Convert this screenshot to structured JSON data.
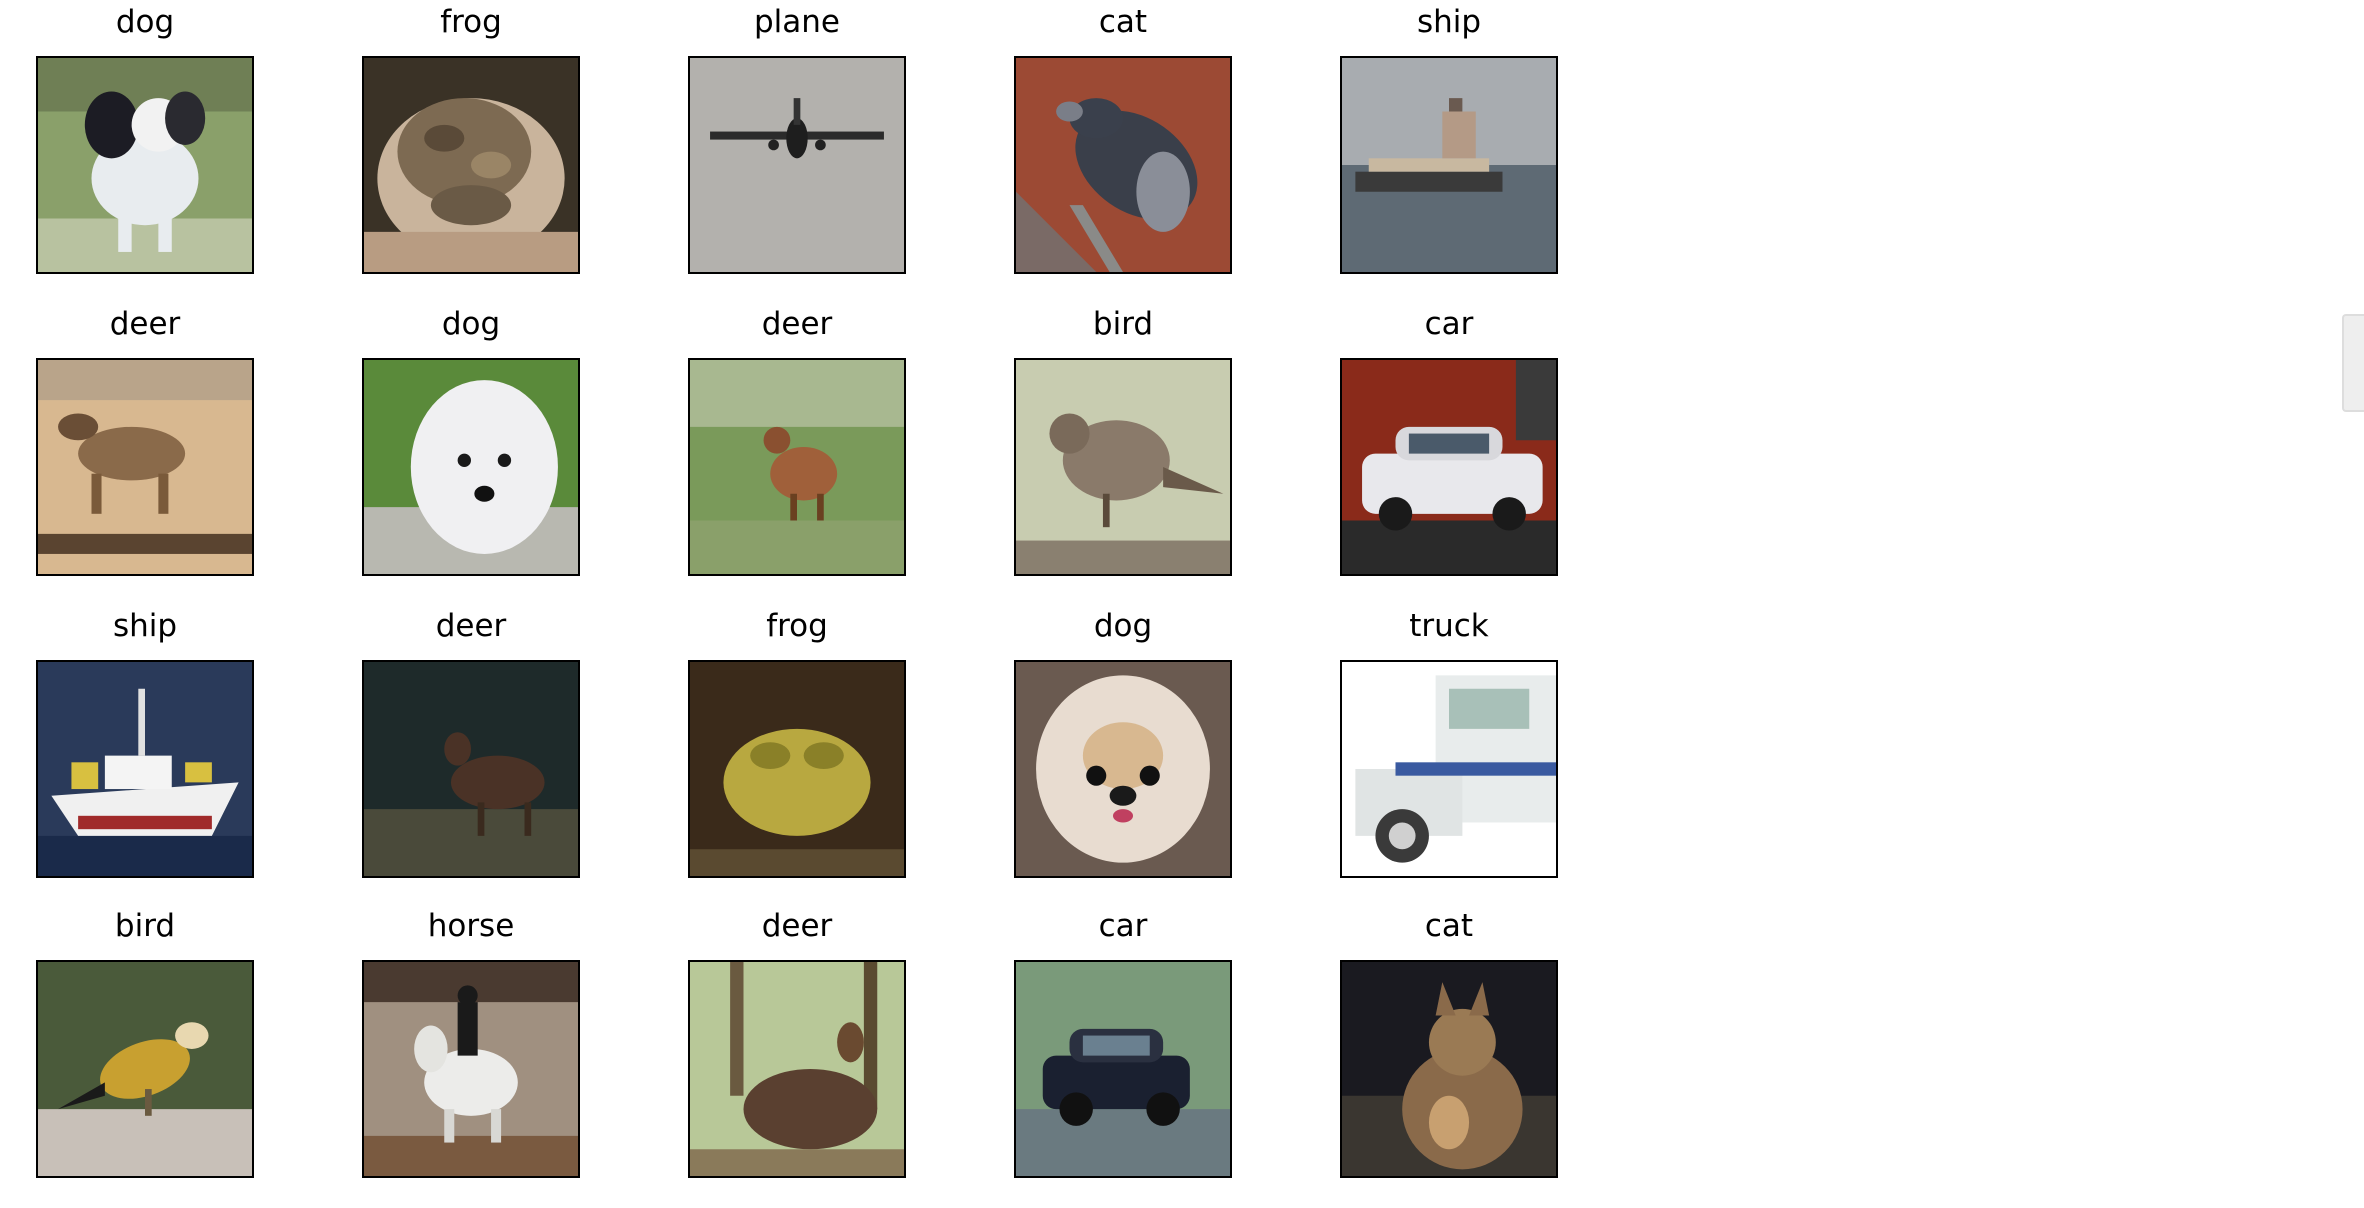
{
  "grid": {
    "rows": 4,
    "columns": 5,
    "cells": [
      {
        "label": "dog",
        "subject": "black-and-white small dog sitting on grass"
      },
      {
        "label": "frog",
        "subject": "brown toad held in a hand"
      },
      {
        "label": "plane",
        "subject": "airliner seen head-on against grey sky"
      },
      {
        "label": "cat",
        "subject": "grey tabby cat lying on terracotta floor"
      },
      {
        "label": "ship",
        "subject": "cargo ship on grey sea"
      },
      {
        "label": "deer",
        "subject": "fawn running on sandy ground"
      },
      {
        "label": "dog",
        "subject": "white fluffy dog face"
      },
      {
        "label": "deer",
        "subject": "deer in tall green grass"
      },
      {
        "label": "bird",
        "subject": "brown sparrow perched on post"
      },
      {
        "label": "car",
        "subject": "white SUV in front of red building"
      },
      {
        "label": "ship",
        "subject": "white and red boat on blue water"
      },
      {
        "label": "deer",
        "subject": "deer in dark forest"
      },
      {
        "label": "frog",
        "subject": "yellow-green frog"
      },
      {
        "label": "dog",
        "subject": "pekingese dog face"
      },
      {
        "label": "truck",
        "subject": "white truck cab"
      },
      {
        "label": "bird",
        "subject": "yellow and black bird on branch"
      },
      {
        "label": "horse",
        "subject": "rider on white horse"
      },
      {
        "label": "deer",
        "subject": "deer standing among trees"
      },
      {
        "label": "car",
        "subject": "dark car on street"
      },
      {
        "label": "cat",
        "subject": "tabby cat on dark background"
      }
    ]
  },
  "colors": {
    "frame": "#000000",
    "background": "#ffffff",
    "text": "#000000"
  }
}
